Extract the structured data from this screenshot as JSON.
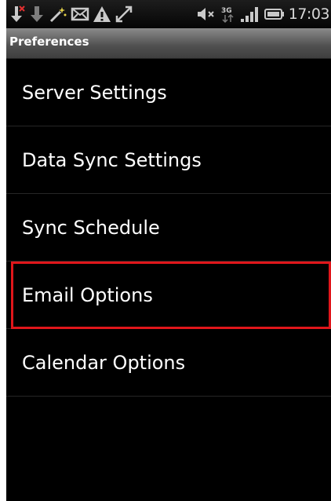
{
  "status_bar": {
    "time": "17:03",
    "network_type": "3G",
    "icons_left": [
      "usb-debug-icon",
      "download-icon",
      "wand-icon",
      "mail-icon",
      "warning-icon",
      "sync-icon"
    ],
    "icons_right": [
      "mute-icon",
      "network-3g-icon",
      "signal-icon",
      "battery-icon"
    ]
  },
  "title_bar": {
    "title": "Preferences"
  },
  "menu": {
    "items": [
      {
        "label": "Server Settings"
      },
      {
        "label": "Data Sync Settings"
      },
      {
        "label": "Sync Schedule"
      },
      {
        "label": "Email Options"
      },
      {
        "label": "Calendar Options"
      }
    ]
  },
  "annotation": {
    "highlight_color": "#e0161b",
    "highlighted_item": "Email Options"
  },
  "colors": {
    "background": "#000000",
    "text": "#ffffff",
    "divider": "#262626"
  }
}
